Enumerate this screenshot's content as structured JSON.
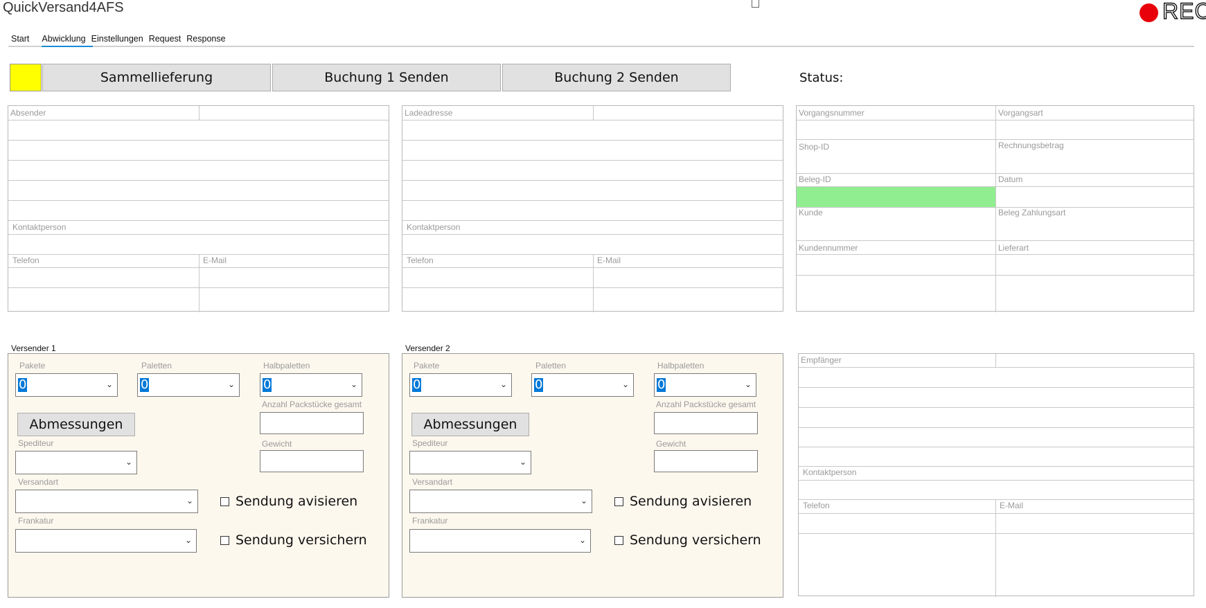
{
  "app": {
    "title": "QuickVersand4AFS",
    "rec_label": "REC",
    "rec_color": "#e8000b"
  },
  "tabs": [
    {
      "label": "Start"
    },
    {
      "label": "Abwicklung"
    },
    {
      "label": "Einstellungen"
    },
    {
      "label": "Request"
    },
    {
      "label": "Response"
    }
  ],
  "toolbar": {
    "sammel_label": "Sammellieferung",
    "buchung1_label": "Buchung 1 Senden",
    "buchung2_label": "Buchung 2 Senden",
    "status_label": "Status:"
  },
  "absender": {
    "title": "Absender",
    "kontakt": "Kontaktperson",
    "telefon": "Telefon",
    "email": "E-Mail"
  },
  "ladeadresse": {
    "title": "Ladeadresse",
    "kontakt": "Kontaktperson",
    "telefon": "Telefon",
    "email": "E-Mail"
  },
  "info": {
    "vorgangsnummer": "Vorgangsnummer",
    "vorgangsart": "Vorgangsart",
    "shop_id": "Shop-ID",
    "rechnungsbetrag": "Rechnungsbetrag",
    "beleg_id": "Beleg-ID",
    "datum": "Datum",
    "kunde": "Kunde",
    "beleg_zahlungsart": "Beleg Zahlungsart",
    "kundennummer": "Kundennummer",
    "lieferart": "Lieferart",
    "highlight_color": "#90ee90"
  },
  "versender1": {
    "title": "Versender 1",
    "pakete_label": "Pakete",
    "pakete_value": "0",
    "paletten_label": "Paletten",
    "paletten_value": "0",
    "halbpaletten_label": "Halbpaletten",
    "halbpaletten_value": "0",
    "anzahl_label": "Anzahl Packstücke gesamt",
    "abmessungen_label": "Abmessungen",
    "spediteur_label": "Spediteur",
    "gewicht_label": "Gewicht",
    "versandart_label": "Versandart",
    "frankatur_label": "Frankatur",
    "avisieren_label": "Sendung avisieren",
    "versichern_label": "Sendung versichern"
  },
  "versender2": {
    "title": "Versender 2",
    "pakete_label": "Pakete",
    "pakete_value": "0",
    "paletten_label": "Paletten",
    "paletten_value": "0",
    "halbpaletten_label": "Halbpaletten",
    "halbpaletten_value": "0",
    "anzahl_label": "Anzahl Packstücke gesamt",
    "abmessungen_label": "Abmessungen",
    "spediteur_label": "Spediteur",
    "gewicht_label": "Gewicht",
    "versandart_label": "Versandart",
    "frankatur_label": "Frankatur",
    "avisieren_label": "Sendung avisieren",
    "versichern_label": "Sendung versichern"
  },
  "empfaenger": {
    "title": "Empfänger",
    "kontakt": "Kontaktperson",
    "telefon": "Telefon",
    "email": "E-Mail"
  },
  "colors": {
    "yellow": "#ffff00",
    "panel_bg": "#fdf8ee",
    "accent": "#1a8bd6",
    "selection": "#0078d7"
  }
}
